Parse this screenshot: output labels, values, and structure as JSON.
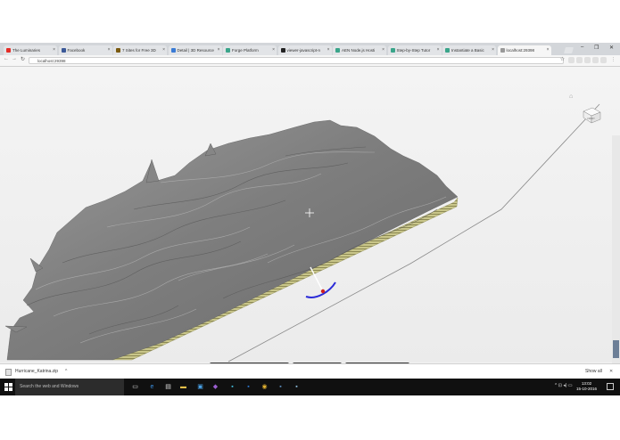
{
  "browser": {
    "tabs": [
      {
        "label": "The Luminaries",
        "icon": "youtube-icon",
        "color": "#e52d27"
      },
      {
        "label": "Facebook",
        "icon": "facebook-icon",
        "color": "#3b5998"
      },
      {
        "label": "7 Sites for Free 3D",
        "icon": "page-icon",
        "color": "#7a5a10"
      },
      {
        "label": "Detail | 3D Resource",
        "icon": "globe-icon",
        "color": "#3a7bd5"
      },
      {
        "label": "Forge Platform",
        "icon": "forge-icon",
        "color": "#3aa58a"
      },
      {
        "label": "viewer-javascript-n",
        "icon": "github-icon",
        "color": "#222222"
      },
      {
        "label": "AEN Node.js Hosti",
        "icon": "forge-icon",
        "color": "#3aa58a"
      },
      {
        "label": "Step-by-Step Tutor",
        "icon": "forge-icon",
        "color": "#3aa58a"
      },
      {
        "label": "Instantiate a Basic",
        "icon": "forge-icon",
        "color": "#3aa58a"
      },
      {
        "label": "localhost:29398",
        "icon": "page-icon",
        "color": "#999999"
      }
    ],
    "window_controls": {
      "minimize": "–",
      "maximize": "❐",
      "close": "✕"
    },
    "nav": {
      "back": "←",
      "forward": "→",
      "reload": "↻"
    },
    "address": "localhost:29398",
    "toolbar_icons": [
      "star-icon",
      "extension-icon",
      "extension-icon",
      "extension-icon",
      "extension-icon",
      "extension-icon",
      "menu-icon"
    ]
  },
  "viewer": {
    "viewcube_label": "FRONT",
    "toolbar_groups": [
      [
        {
          "name": "orbit-tool-icon",
          "glyph": "✥",
          "active": true
        },
        {
          "name": "pan-tool-icon",
          "glyph": "✋",
          "active": false
        },
        {
          "name": "zoom-tool-icon",
          "glyph": "↕",
          "active": false
        },
        {
          "name": "first-person-icon",
          "glyph": "♙",
          "active": false
        },
        {
          "name": "camera-icon",
          "glyph": "■",
          "active": false
        }
      ],
      [
        {
          "name": "measure-icon",
          "glyph": "⤡",
          "active": false
        },
        {
          "name": "section-icon",
          "glyph": "▭",
          "active": false
        },
        {
          "name": "explode-icon",
          "glyph": "◈",
          "active": false
        }
      ],
      [
        {
          "name": "model-browser-icon",
          "glyph": "⋔",
          "active": false
        },
        {
          "name": "properties-icon",
          "glyph": "▤",
          "active": false
        },
        {
          "name": "settings-icon",
          "glyph": "⚙",
          "active": false
        },
        {
          "name": "fullscreen-icon",
          "glyph": "⤢",
          "active": false
        }
      ]
    ]
  },
  "downloads": {
    "file_name": "Hurricane_Katrina.zip",
    "caret": "^",
    "show_all": "Show all",
    "close": "✕"
  },
  "taskbar": {
    "search_placeholder": "Search the web and Windows",
    "apps": [
      {
        "name": "task-view-icon",
        "glyph": "▭",
        "color": "#dddddd"
      },
      {
        "name": "edge-icon",
        "glyph": "e",
        "color": "#3b8fe0"
      },
      {
        "name": "store-icon",
        "glyph": "▤",
        "color": "#dddddd"
      },
      {
        "name": "file-explorer-icon",
        "glyph": "▬",
        "color": "#e8c04a"
      },
      {
        "name": "store-bag-icon",
        "glyph": "▣",
        "color": "#4aa3e8"
      },
      {
        "name": "visual-studio-icon",
        "glyph": "◆",
        "color": "#9b5fd0"
      },
      {
        "name": "app-icon",
        "glyph": "▪",
        "color": "#44c1e0"
      },
      {
        "name": "outlook-icon",
        "glyph": "▪",
        "color": "#2e7bd6"
      },
      {
        "name": "chrome-icon",
        "glyph": "◉",
        "color": "#e0b030"
      },
      {
        "name": "app-icon-2",
        "glyph": "▪",
        "color": "#5c8fc0"
      },
      {
        "name": "app-icon-3",
        "glyph": "▪",
        "color": "#8fc0e0"
      }
    ],
    "tray": "^ ⊡ ◂) ▭",
    "time": "13:02",
    "date": "15-10-2016"
  }
}
